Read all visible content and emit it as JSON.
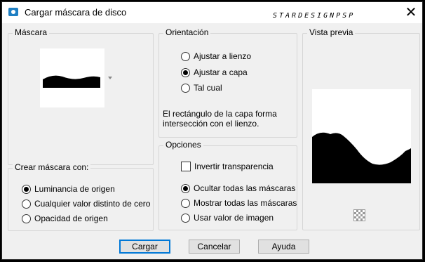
{
  "window": {
    "title": "Cargar máscara de disco",
    "brand": "STARDESIGNPSP",
    "close_glyph": "✕"
  },
  "mask_group": {
    "label": "Máscara"
  },
  "create_group": {
    "label": "Crear máscara con:",
    "options": [
      {
        "label": "Luminancia de origen",
        "selected": true
      },
      {
        "label": "Cualquier valor distinto de cero",
        "selected": false
      },
      {
        "label": "Opacidad de origen",
        "selected": false
      }
    ]
  },
  "orientation_group": {
    "label": "Orientación",
    "options": [
      {
        "label": "Ajustar a lienzo",
        "selected": false
      },
      {
        "label": "Ajustar a capa",
        "selected": true
      },
      {
        "label": "Tal cual",
        "selected": false
      }
    ],
    "description": "El rectángulo de la capa forma intersección con el lienzo."
  },
  "options_group": {
    "label": "Opciones",
    "invert_label": "Invertir transparencia",
    "invert_checked": false,
    "options": [
      {
        "label": "Ocultar todas las máscaras",
        "selected": true
      },
      {
        "label": "Mostrar todas las máscaras",
        "selected": false
      },
      {
        "label": "Usar valor de imagen",
        "selected": false
      }
    ]
  },
  "preview_group": {
    "label": "Vista previa"
  },
  "buttons": {
    "load": "Cargar",
    "cancel": "Cancelar",
    "help": "Ayuda"
  },
  "icons": {
    "title_icon": "camera-icon",
    "preview_icon": "checkerboard-icon",
    "dropdown_icon": "chevron-down-icon"
  }
}
